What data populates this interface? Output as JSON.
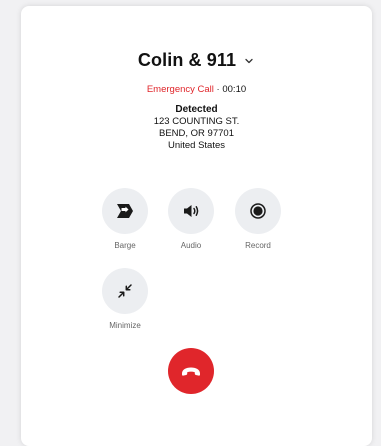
{
  "call": {
    "title": "Colin & 911",
    "status_label": "Emergency Call",
    "separator": "·",
    "duration": "00:10"
  },
  "location": {
    "heading": "Detected",
    "street": "123 COUNTING ST.",
    "city": "BEND, OR 97701",
    "country": "United States"
  },
  "controls": {
    "barge": "Barge",
    "audio": "Audio",
    "record": "Record",
    "minimize": "Minimize"
  },
  "icons": {
    "title_dropdown": "chevron-down-icon",
    "barge": "barge-arrow-icon",
    "audio": "speaker-icon",
    "record": "record-icon",
    "minimize": "minimize-arrows-icon",
    "end_call": "hang-up-phone-icon"
  },
  "colors": {
    "emergency": "#e0262b",
    "end_call": "#e0262b",
    "button_bg": "#eceef1"
  }
}
